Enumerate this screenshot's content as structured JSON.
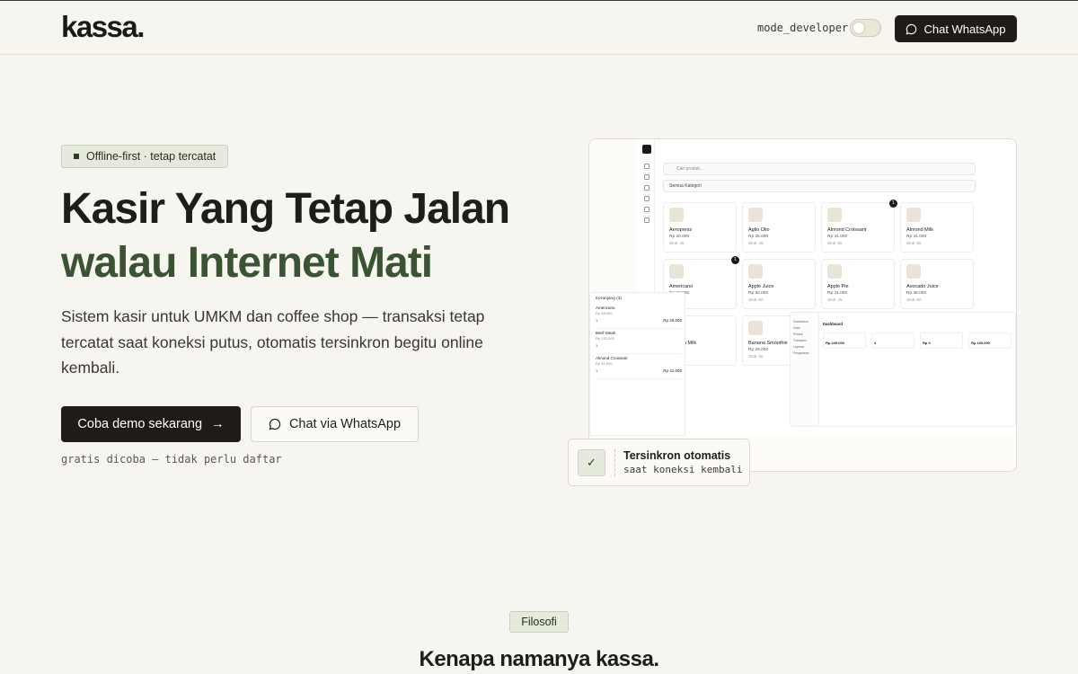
{
  "header": {
    "logo": "kassa.",
    "dev_label": "mode_developer",
    "dev_toggle_on": false,
    "cta_label": "Chat WhatsApp"
  },
  "hero": {
    "badge": "Offline-first · tetap tercatat",
    "title_line1": "Kasir Yang Tetap Jalan",
    "title_line2": "walau Internet Mati",
    "lead": "Sistem kasir untuk UMKM dan coffee shop — transaksi tetap tercatat saat koneksi putus, otomatis tersinkron begitu online kembali.",
    "primary_button": "Coba demo sekarang",
    "primary_arrow": "→",
    "secondary_button": "Chat via WhatsApp",
    "note": "gratis dicoba — tidak perlu daftar"
  },
  "mockup": {
    "search_placeholder": "Cari produk...",
    "category": "Semua Kategori",
    "products": [
      {
        "name": "Aeropress",
        "price": "Rp 20.000",
        "stock": "Stok: 46"
      },
      {
        "name": "Aglio Olio",
        "price": "Rp 35.000",
        "stock": "Stok: 48"
      },
      {
        "name": "Almond Croissant",
        "price": "Rp 41.000",
        "stock": "Stok: 50",
        "badge": "1"
      },
      {
        "name": "Almond Milk",
        "price": "Rp 41.000",
        "stock": "Stok: 50"
      },
      {
        "name": "Americano",
        "price": "Rp 28.000",
        "stock": "Stok: 50",
        "badge": "1"
      },
      {
        "name": "Apple Juice",
        "price": "Rp 32.000",
        "stock": "Stok: 50"
      },
      {
        "name": "Apple Pie",
        "price": "Rp 41.000",
        "stock": "Stok: 45"
      },
      {
        "name": "Avocado Juice",
        "price": "Rp 38.000",
        "stock": "Stok: 50"
      },
      {
        "name": "Banana Milk",
        "price": "",
        "stock": ""
      },
      {
        "name": "Banana Smoothie",
        "price": "Rp 28.000",
        "stock": "Stok: 50"
      }
    ],
    "cart_title": "Keranjang (3)",
    "cart_items": [
      {
        "name": "Americano",
        "price": "Rp 28.000",
        "qty": "1",
        "total": "Rp 28.000"
      },
      {
        "name": "Beef Steak",
        "price": "Rp 120.000",
        "qty": "1",
        "total": "Rp 120.000"
      },
      {
        "name": "Almond Croissant",
        "price": "Rp 41.000",
        "qty": "1",
        "total": "Rp 41.000"
      }
    ],
    "dashboard_title": "Dashboard",
    "dashboard_stats": [
      "Rp 249.000",
      "3",
      "Rp 0",
      "Rp 249.000"
    ],
    "dashboard_menu": [
      "Dashboard",
      "Kasir",
      "Produk",
      "Transaksi",
      "Laporan",
      "Pengaturan"
    ]
  },
  "sync_card": {
    "title": "Tersinkron otomatis",
    "subtitle": "saat koneksi kembali",
    "check": "✓"
  },
  "section": {
    "badge": "Filosofi",
    "title": "Kenapa namanya kassa."
  }
}
